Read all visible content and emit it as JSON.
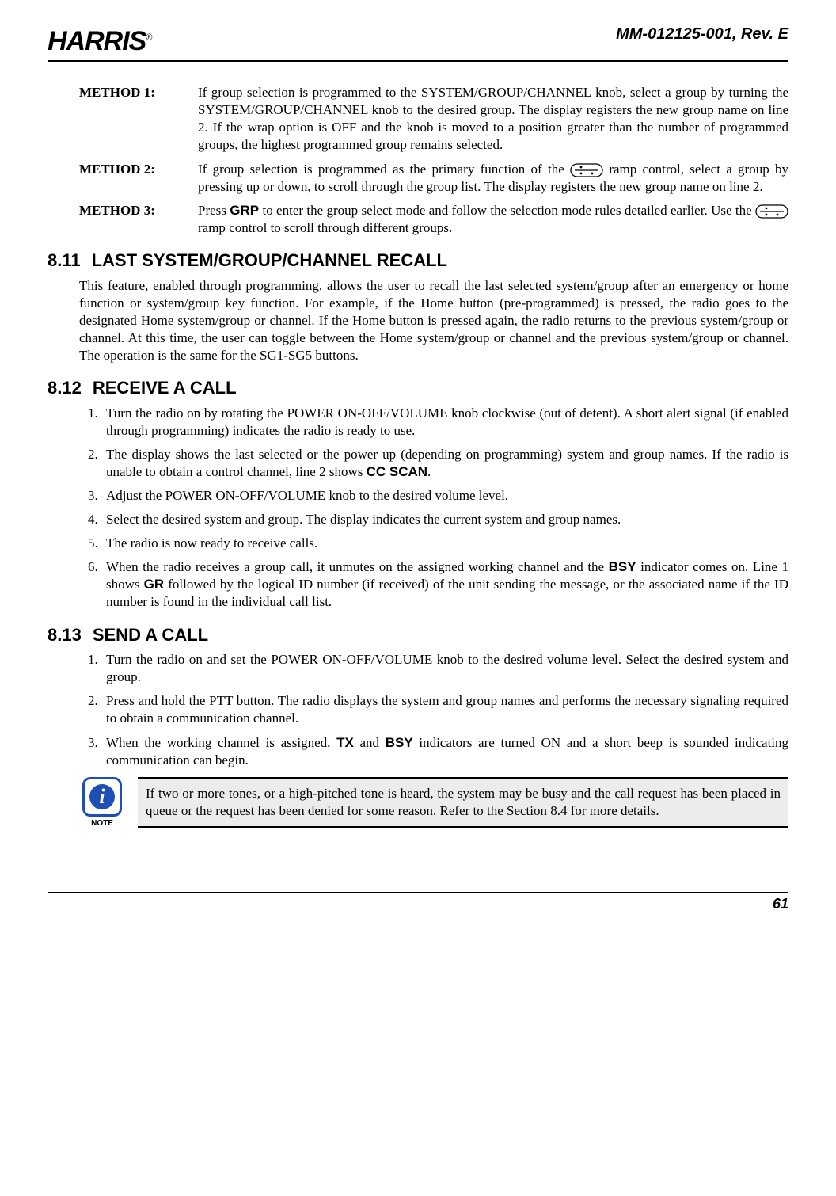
{
  "header": {
    "brand": "HARRIS",
    "reg": "®",
    "doc_id": "MM-012125-001, Rev. E"
  },
  "methods": [
    {
      "label": "METHOD 1:",
      "text": "If group selection is programmed to the SYSTEM/GROUP/CHANNEL knob, select a group by turning the SYSTEM/GROUP/CHANNEL knob to the desired group. The display registers the new group name on line 2. If the wrap option is OFF and the knob is moved to a position greater than the number of programmed groups, the highest programmed group remains selected."
    },
    {
      "label": "METHOD 2:",
      "text_pre": "If group selection is programmed as the primary function of the ",
      "text_post": " ramp control, select a group by pressing up or down, to scroll through the group list. The display registers the new group name on line 2."
    },
    {
      "label": "METHOD 3:",
      "text_pre": "Press ",
      "grp": "GRP",
      "text_mid": " to enter the group select mode and follow the selection mode rules detailed earlier. Use the ",
      "text_post": " ramp control to scroll through different groups."
    }
  ],
  "sections": {
    "s811": {
      "num": "8.11",
      "title": "LAST SYSTEM/GROUP/CHANNEL RECALL",
      "para": "This feature, enabled through programming, allows the user to recall the last selected system/group after an emergency or home function or system/group key function. For example, if the Home button (pre-programmed) is pressed, the radio goes to the designated Home system/group or channel. If the Home button is pressed again, the radio returns to the previous system/group or channel. At this time, the user can toggle between the Home system/group or channel and the previous system/group or channel. The operation is the same for the SG1-SG5 buttons."
    },
    "s812": {
      "num": "8.12",
      "title": "RECEIVE A CALL"
    },
    "s812_items": [
      {
        "t": "Turn the radio on by rotating the POWER ON-OFF/VOLUME knob clockwise (out of detent). A short alert signal (if enabled through programming) indicates the radio is ready to use."
      },
      {
        "pre": "The display shows the last selected or the power up (depending on programming) system and group names. If the radio is unable to obtain a control channel, line 2 shows ",
        "b": "CC SCAN",
        "post": "."
      },
      {
        "t": "Adjust the POWER ON-OFF/VOLUME knob to the desired volume level."
      },
      {
        "t": "Select the desired system and group. The display indicates the current system and group names."
      },
      {
        "t": "The radio is now ready to receive calls."
      },
      {
        "pre": "When the radio receives a group call, it unmutes on the assigned working channel and the ",
        "b": "BSY",
        "mid": " indicator comes on. Line 1 shows ",
        "b2": "GR",
        "post": " followed by the logical ID number (if received) of the unit sending the message, or the associated name if the ID number is found in the individual call list."
      }
    ],
    "s813": {
      "num": "8.13",
      "title": "SEND A CALL"
    },
    "s813_items": [
      {
        "t": "Turn the radio on and set the POWER ON-OFF/VOLUME knob to the desired volume level. Select the desired system and group."
      },
      {
        "t": "Press and hold the PTT button. The radio displays the system and group names and performs the necessary signaling required to obtain a communication channel."
      },
      {
        "pre": "When the working channel is assigned, ",
        "b": "TX",
        "mid": " and ",
        "b2": "BSY",
        "post": " indicators are turned ON and a short beep is sounded indicating communication can begin."
      }
    ]
  },
  "note": {
    "label": "NOTE",
    "text": "If two or more tones, or a high-pitched tone is heard, the system may be busy and the call request has been placed in queue or the request has been denied for some reason. Refer to the Section 8.4 for more details."
  },
  "footer": {
    "page": "61"
  }
}
